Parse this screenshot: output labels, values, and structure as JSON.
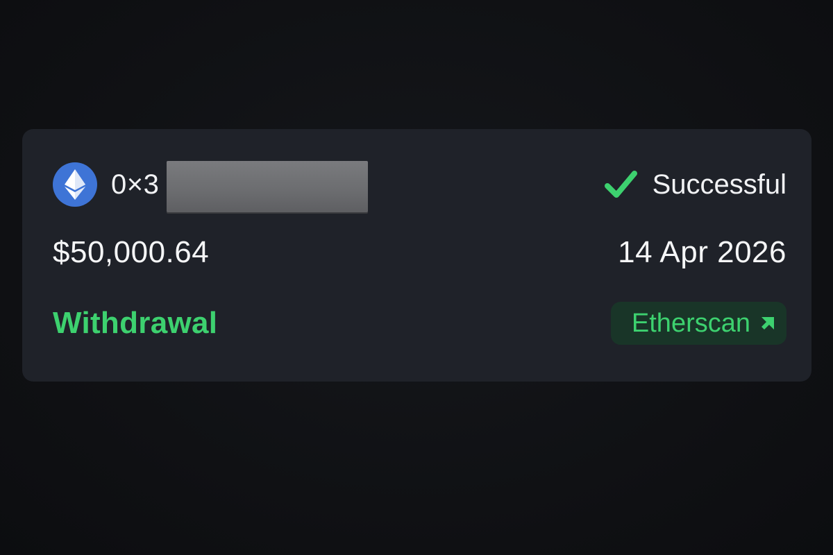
{
  "transaction": {
    "address_prefix": "0×3",
    "status_label": "Successful",
    "amount": "$50,000.64",
    "date": "14 Apr 2026",
    "type_label": "Withdrawal",
    "explorer_label": "Etherscan"
  },
  "colors": {
    "page_background": "#101114",
    "card_background": "#1f2229",
    "eth_icon_background": "#3e74d6",
    "success_green": "#3dd16f",
    "button_background": "#193528",
    "text_primary": "#f1f2f4",
    "redaction_gray": "#6b6c6f"
  },
  "icons": {
    "coin": "ethereum-icon",
    "status": "checkmark-icon",
    "link": "external-link-icon"
  }
}
